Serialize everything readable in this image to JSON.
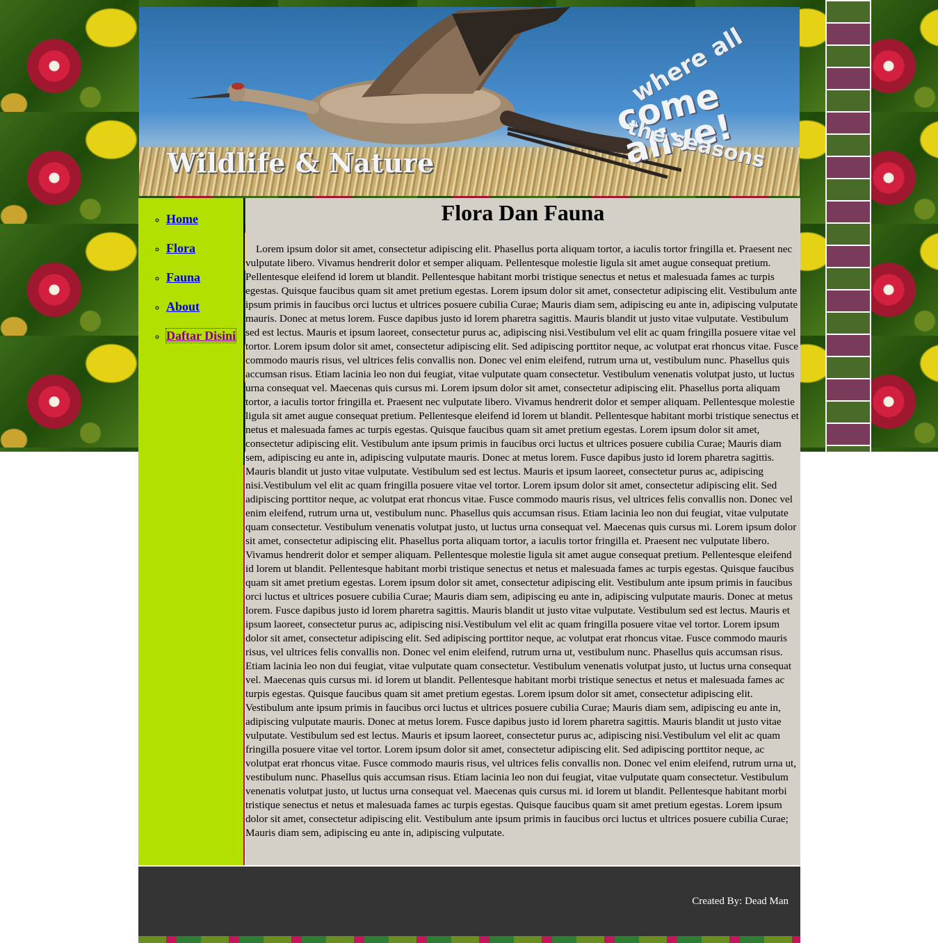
{
  "header": {
    "banner_title": "Wildlife & Nature",
    "badge": {
      "line1": "where all",
      "line2": "come alive!",
      "line3": "the seasons"
    }
  },
  "nav": {
    "items": [
      {
        "label": "Home",
        "state": "link"
      },
      {
        "label": "Flora",
        "state": "link"
      },
      {
        "label": "Fauna",
        "state": "link"
      },
      {
        "label": "About",
        "state": "link"
      },
      {
        "label": "Daftar Disini",
        "state": "visited-focused"
      }
    ]
  },
  "content": {
    "title": "Flora Dan Fauna",
    "body": "Lorem ipsum dolor sit amet, consectetur adipiscing elit. Phasellus porta aliquam tortor, a iaculis tortor fringilla et. Praesent nec vulputate libero. Vivamus hendrerit dolor et semper aliquam. Pellentesque molestie ligula sit amet augue consequat pretium. Pellentesque eleifend id lorem ut blandit. Pellentesque habitant morbi tristique senectus et netus et malesuada fames ac turpis egestas. Quisque faucibus quam sit amet pretium egestas. Lorem ipsum dolor sit amet, consectetur adipiscing elit. Vestibulum ante ipsum primis in faucibus orci luctus et ultrices posuere cubilia Curae; Mauris diam sem, adipiscing eu ante in, adipiscing vulputate mauris. Donec at metus lorem. Fusce dapibus justo id lorem pharetra sagittis. Mauris blandit ut justo vitae vulputate. Vestibulum sed est lectus. Mauris et ipsum laoreet, consectetur purus ac, adipiscing nisi.Vestibulum vel elit ac quam fringilla posuere vitae vel tortor. Lorem ipsum dolor sit amet, consectetur adipiscing elit. Sed adipiscing porttitor neque, ac volutpat erat rhoncus vitae. Fusce commodo mauris risus, vel ultrices felis convallis non. Donec vel enim eleifend, rutrum urna ut, vestibulum nunc. Phasellus quis accumsan risus. Etiam lacinia leo non dui feugiat, vitae vulputate quam consectetur. Vestibulum venenatis volutpat justo, ut luctus urna consequat vel. Maecenas quis cursus mi. Lorem ipsum dolor sit amet, consectetur adipiscing elit. Phasellus porta aliquam tortor, a iaculis tortor fringilla et. Praesent nec vulputate libero. Vivamus hendrerit dolor et semper aliquam. Pellentesque molestie ligula sit amet augue consequat pretium. Pellentesque eleifend id lorem ut blandit. Pellentesque habitant morbi tristique senectus et netus et malesuada fames ac turpis egestas. Quisque faucibus quam sit amet pretium egestas. Lorem ipsum dolor sit amet, consectetur adipiscing elit. Vestibulum ante ipsum primis in faucibus orci luctus et ultrices posuere cubilia Curae; Mauris diam sem, adipiscing eu ante in, adipiscing vulputate mauris. Donec at metus lorem. Fusce dapibus justo id lorem pharetra sagittis. Mauris blandit ut justo vitae vulputate. Vestibulum sed est lectus. Mauris et ipsum laoreet, consectetur purus ac, adipiscing nisi.Vestibulum vel elit ac quam fringilla posuere vitae vel tortor. Lorem ipsum dolor sit amet, consectetur adipiscing elit. Sed adipiscing porttitor neque, ac volutpat erat rhoncus vitae. Fusce commodo mauris risus, vel ultrices felis convallis non. Donec vel enim eleifend, rutrum urna ut, vestibulum nunc. Phasellus quis accumsan risus. Etiam lacinia leo non dui feugiat, vitae vulputate quam consectetur. Vestibulum venenatis volutpat justo, ut luctus urna consequat vel. Maecenas quis cursus mi. Lorem ipsum dolor sit amet, consectetur adipiscing elit. Phasellus porta aliquam tortor, a iaculis tortor fringilla et. Praesent nec vulputate libero. Vivamus hendrerit dolor et semper aliquam. Pellentesque molestie ligula sit amet augue consequat pretium. Pellentesque eleifend id lorem ut blandit. Pellentesque habitant morbi tristique senectus et netus et malesuada fames ac turpis egestas. Quisque faucibus quam sit amet pretium egestas. Lorem ipsum dolor sit amet, consectetur adipiscing elit. Vestibulum ante ipsum primis in faucibus orci luctus et ultrices posuere cubilia Curae; Mauris diam sem, adipiscing eu ante in, adipiscing vulputate mauris. Donec at metus lorem. Fusce dapibus justo id lorem pharetra sagittis. Mauris blandit ut justo vitae vulputate. Vestibulum sed est lectus. Mauris et ipsum laoreet, consectetur purus ac, adipiscing nisi.Vestibulum vel elit ac quam fringilla posuere vitae vel tortor. Lorem ipsum dolor sit amet, consectetur adipiscing elit. Sed adipiscing porttitor neque, ac volutpat erat rhoncus vitae. Fusce commodo mauris risus, vel ultrices felis convallis non. Donec vel enim eleifend, rutrum urna ut, vestibulum nunc. Phasellus quis accumsan risus. Etiam lacinia leo non dui feugiat, vitae vulputate quam consectetur. Vestibulum venenatis volutpat justo, ut luctus urna consequat vel. Maecenas quis cursus mi. id lorem ut blandit. Pellentesque habitant morbi tristique senectus et netus et malesuada fames ac turpis egestas. Quisque faucibus quam sit amet pretium egestas. Lorem ipsum dolor sit amet, consectetur adipiscing elit. Vestibulum ante ipsum primis in faucibus orci luctus et ultrices posuere cubilia Curae; Mauris diam sem, adipiscing eu ante in, adipiscing vulputate mauris. Donec at metus lorem. Fusce dapibus justo id lorem pharetra sagittis. Mauris blandit ut justo vitae vulputate. Vestibulum sed est lectus. Mauris et ipsum laoreet, consectetur purus ac, adipiscing nisi.Vestibulum vel elit ac quam fringilla posuere vitae vel tortor. Lorem ipsum dolor sit amet, consectetur adipiscing elit. Sed adipiscing porttitor neque, ac volutpat erat rhoncus vitae. Fusce commodo mauris risus, vel ultrices felis convallis non. Donec vel enim eleifend, rutrum urna ut, vestibulum nunc. Phasellus quis accumsan risus. Etiam lacinia leo non dui feugiat, vitae vulputate quam consectetur. Vestibulum venenatis volutpat justo, ut luctus urna consequat vel. Maecenas quis cursus mi. id lorem ut blandit. Pellentesque habitant morbi tristique senectus et netus et malesuada fames ac turpis egestas. Quisque faucibus quam sit amet pretium egestas. Lorem ipsum dolor sit amet, consectetur adipiscing elit. Vestibulum ante ipsum primis in faucibus orci luctus et ultrices posuere cubilia Curae; Mauris diam sem, adipiscing eu ante in, adipiscing vulputate."
  },
  "footer": {
    "credit": "Created By: Dead Man"
  },
  "colors": {
    "sidebar_bg": "#b2e000",
    "content_bg": "#d4d0c8",
    "footer_bg": "#333333",
    "link": "#0000ee",
    "link_visited": "#800080"
  }
}
